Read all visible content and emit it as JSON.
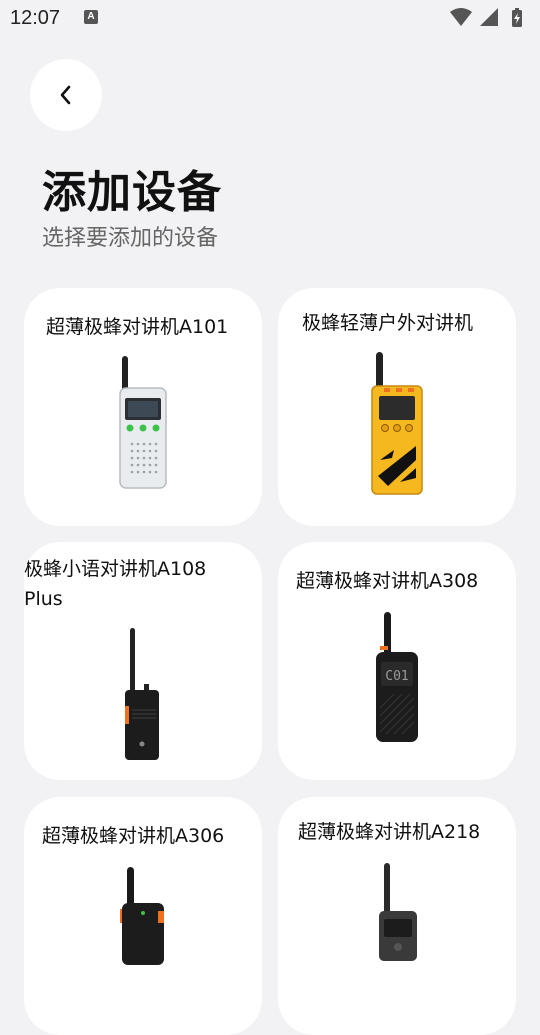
{
  "status_bar": {
    "time": "12:07",
    "notification_icon": "A",
    "icons": [
      "wifi-icon",
      "signal-icon",
      "battery-charging-icon"
    ]
  },
  "header": {
    "back_icon": "chevron-left-icon",
    "title": "添加设备",
    "subtitle": "选择要添加的设备"
  },
  "devices": [
    {
      "name": "超薄极蜂对讲机A101",
      "image": "white walkie-talkie with screen and green buttons"
    },
    {
      "name": "极蜂轻薄户外对讲机",
      "image": "yellow outdoor walkie-talkie"
    },
    {
      "name_line1": "极蜂小语对讲机A108",
      "name_line2": "Plus",
      "image": "black walkie-talkie with orange side button"
    },
    {
      "name": "超薄极蜂对讲机A308",
      "image": "black walkie-talkie with C01 display"
    },
    {
      "name": "超薄极蜂对讲机A306",
      "image": "black walkie-talkie with orange buttons"
    },
    {
      "name": "超薄极蜂对讲机A218",
      "image": "dark grey walkie-talkie"
    }
  ],
  "colors": {
    "background": "#f2f2f4",
    "card": "#ffffff",
    "accent_green": "#3cc14a",
    "accent_orange": "#f07020",
    "yellow_device": "#f6b81f"
  }
}
